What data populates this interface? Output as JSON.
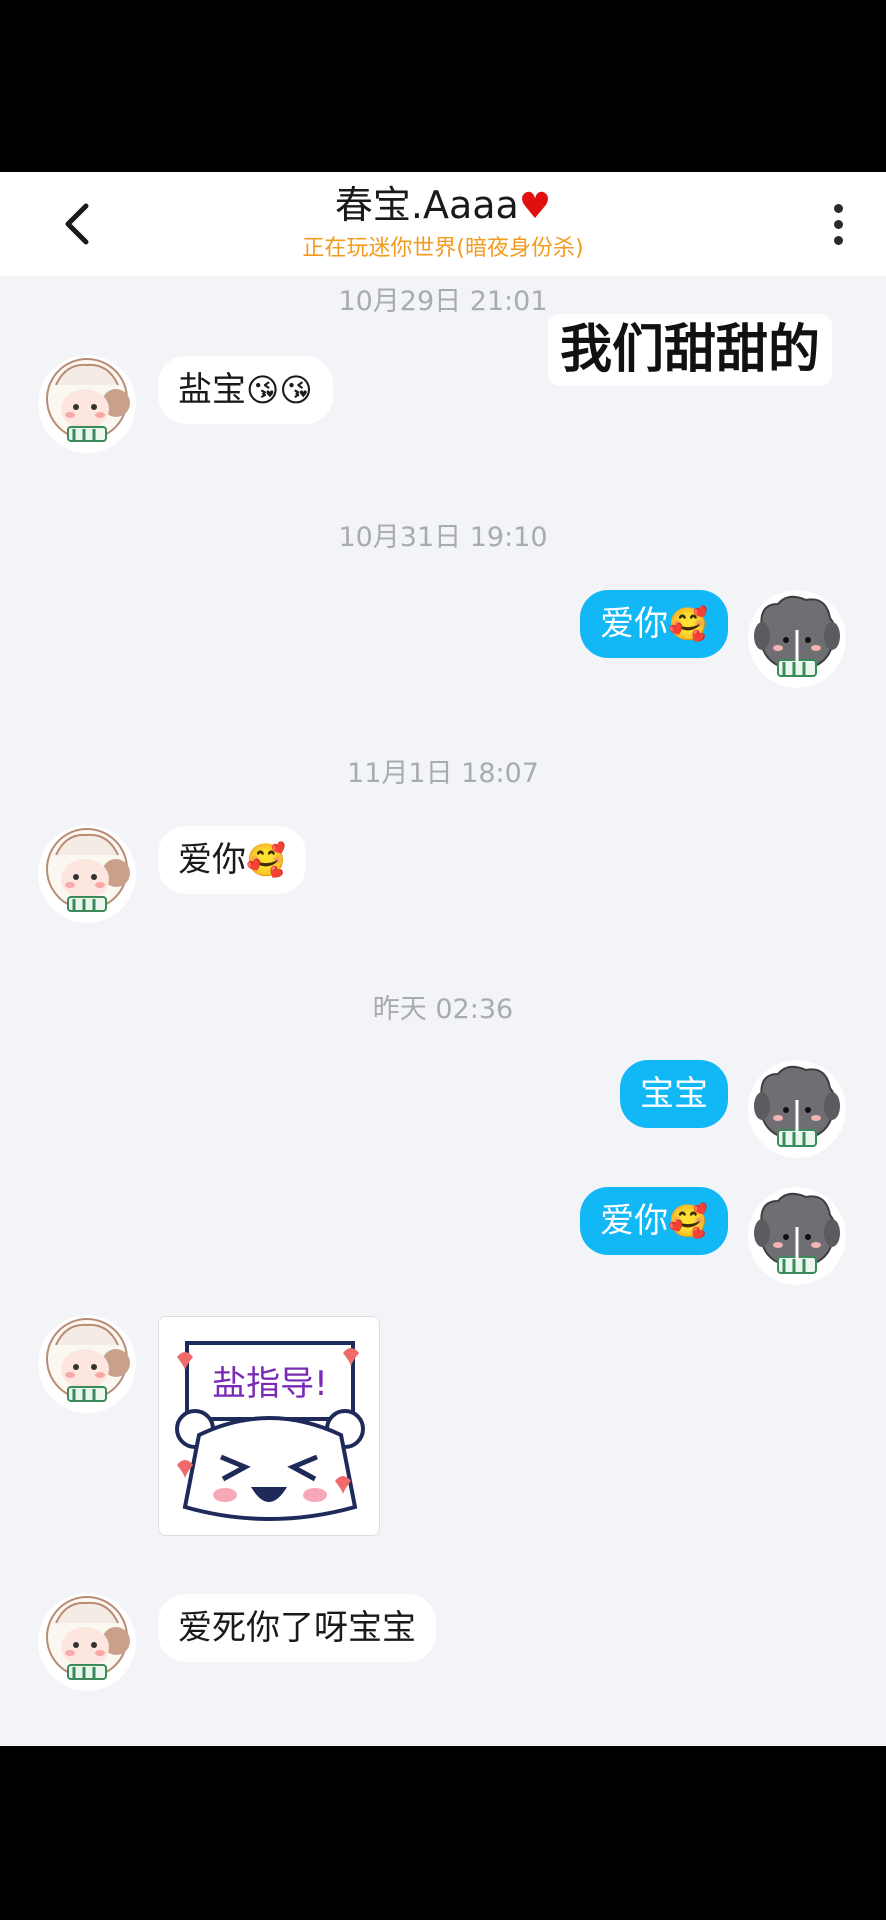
{
  "header": {
    "title": "春宝.Aaaa",
    "title_heart": "♥",
    "subtitle": "正在玩迷你世界(暗夜身份杀)"
  },
  "caption": "我们甜甜的",
  "timestamps": [
    "10月29日 21:01",
    "10月31日 19:10",
    "11月1日 18:07",
    "昨天 02:36"
  ],
  "messages": [
    {
      "side": "in",
      "text": "盐宝",
      "emoji": "😘😘"
    },
    {
      "side": "out",
      "text": "爱你",
      "emoji": "🥰"
    },
    {
      "side": "in",
      "text": "爱你",
      "emoji": "🥰"
    },
    {
      "side": "out",
      "text": "宝宝",
      "emoji": ""
    },
    {
      "side": "out",
      "text": "爱你",
      "emoji": "🥰"
    },
    {
      "side": "in",
      "sticker_text": "盐指导!"
    },
    {
      "side": "in",
      "text": "爱死你了呀宝宝",
      "emoji": ""
    }
  ],
  "colors": {
    "outgoing_bubble": "#12b7f5",
    "incoming_bubble": "#ffffff",
    "subtitle": "#f39b1f",
    "background": "#f3f4f8"
  },
  "icons": {
    "back": "chevron-left-icon",
    "more": "vertical-ellipsis-icon",
    "avatar_incoming": "sheep-avatar",
    "avatar_outgoing": "gray-sheep-avatar"
  }
}
